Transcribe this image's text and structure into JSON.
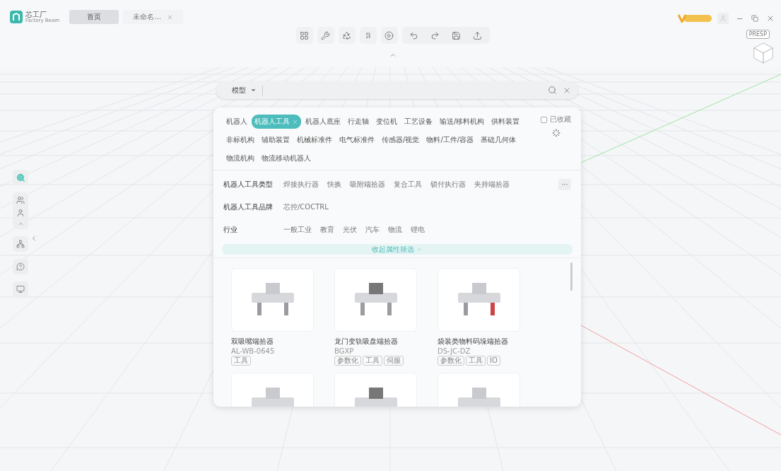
{
  "app": {
    "logo_text": "芯工厂",
    "logo_subtext": "Factory Beam"
  },
  "tabs": [
    {
      "label": "首页",
      "selected": true,
      "closable": false
    },
    {
      "label": "未命名…",
      "selected": false,
      "closable": true
    }
  ],
  "view_cube": {
    "mode": "PRESP"
  },
  "search": {
    "scope": "模型"
  },
  "categories": [
    {
      "label": "机器人",
      "selected": false
    },
    {
      "label": "机器人工具",
      "selected": true
    },
    {
      "label": "机器人底座",
      "selected": false
    },
    {
      "label": "行走轴",
      "selected": false
    },
    {
      "label": "变位机",
      "selected": false
    },
    {
      "label": "工艺设备",
      "selected": false
    },
    {
      "label": "输送/移料机构",
      "selected": false
    },
    {
      "label": "供料装置",
      "selected": false
    },
    {
      "label": "非标机构",
      "selected": false
    },
    {
      "label": "辅助装置",
      "selected": false
    },
    {
      "label": "机械标准件",
      "selected": false
    },
    {
      "label": "电气标准件",
      "selected": false
    },
    {
      "label": "传感器/视觉",
      "selected": false
    },
    {
      "label": "物料/工件/容器",
      "selected": false
    },
    {
      "label": "基础几何体",
      "selected": false
    },
    {
      "label": "物流机构",
      "selected": false
    },
    {
      "label": "物流移动机器人",
      "selected": false
    }
  ],
  "favorites": {
    "label": "已收藏",
    "checked": false
  },
  "filters": [
    {
      "label": "机器人工具类型",
      "options": [
        "焊接执行器",
        "快换",
        "吸附端拾器",
        "复合工具",
        "锁付执行器",
        "夹持端拾器"
      ],
      "more": "···"
    },
    {
      "label": "机器人工具品牌",
      "options": [
        "芯控/COCTRL"
      ]
    },
    {
      "label": "行业",
      "options": [
        "一般工业",
        "教育",
        "光伏",
        "汽车",
        "物流",
        "锂电"
      ]
    }
  ],
  "collapse_label": "收起属性筛选",
  "products": [
    {
      "kind": "full",
      "name": "双吸嘴端拾器",
      "code": "AL-WB-0645",
      "tags": [
        "工具"
      ]
    },
    {
      "kind": "full",
      "name": "龙门变轨吸盘端拾器",
      "code": "BGXP",
      "tags": [
        "参数化",
        "工具",
        "伺服"
      ]
    },
    {
      "kind": "full",
      "name": "袋装类物料码垛端拾器",
      "code": "DS-JC-DZ",
      "tags": [
        "参数化",
        "工具",
        "IO"
      ]
    },
    {
      "kind": "thumbnail"
    },
    {
      "kind": "thumbnail"
    },
    {
      "kind": "thumbnail"
    }
  ]
}
